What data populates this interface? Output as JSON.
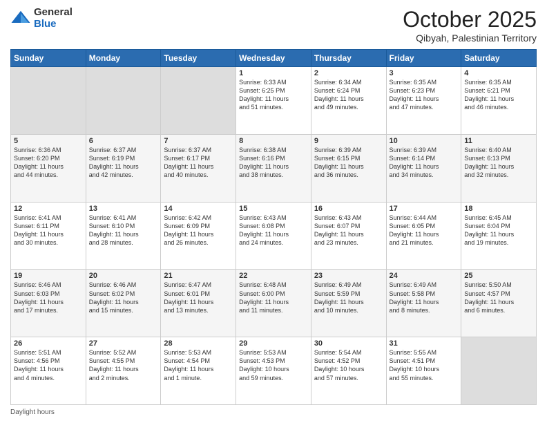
{
  "header": {
    "logo_general": "General",
    "logo_blue": "Blue",
    "month_title": "October 2025",
    "location": "Qibyah, Palestinian Territory"
  },
  "footer": {
    "daylight_label": "Daylight hours"
  },
  "days_of_week": [
    "Sunday",
    "Monday",
    "Tuesday",
    "Wednesday",
    "Thursday",
    "Friday",
    "Saturday"
  ],
  "weeks": [
    {
      "row_class": "row-1",
      "days": [
        {
          "number": "",
          "info": "",
          "empty": true
        },
        {
          "number": "",
          "info": "",
          "empty": true
        },
        {
          "number": "",
          "info": "",
          "empty": true
        },
        {
          "number": "1",
          "info": "Sunrise: 6:33 AM\nSunset: 6:25 PM\nDaylight: 11 hours\nand 51 minutes.",
          "empty": false
        },
        {
          "number": "2",
          "info": "Sunrise: 6:34 AM\nSunset: 6:24 PM\nDaylight: 11 hours\nand 49 minutes.",
          "empty": false
        },
        {
          "number": "3",
          "info": "Sunrise: 6:35 AM\nSunset: 6:23 PM\nDaylight: 11 hours\nand 47 minutes.",
          "empty": false
        },
        {
          "number": "4",
          "info": "Sunrise: 6:35 AM\nSunset: 6:21 PM\nDaylight: 11 hours\nand 46 minutes.",
          "empty": false
        }
      ]
    },
    {
      "row_class": "row-2",
      "days": [
        {
          "number": "5",
          "info": "Sunrise: 6:36 AM\nSunset: 6:20 PM\nDaylight: 11 hours\nand 44 minutes.",
          "empty": false
        },
        {
          "number": "6",
          "info": "Sunrise: 6:37 AM\nSunset: 6:19 PM\nDaylight: 11 hours\nand 42 minutes.",
          "empty": false
        },
        {
          "number": "7",
          "info": "Sunrise: 6:37 AM\nSunset: 6:17 PM\nDaylight: 11 hours\nand 40 minutes.",
          "empty": false
        },
        {
          "number": "8",
          "info": "Sunrise: 6:38 AM\nSunset: 6:16 PM\nDaylight: 11 hours\nand 38 minutes.",
          "empty": false
        },
        {
          "number": "9",
          "info": "Sunrise: 6:39 AM\nSunset: 6:15 PM\nDaylight: 11 hours\nand 36 minutes.",
          "empty": false
        },
        {
          "number": "10",
          "info": "Sunrise: 6:39 AM\nSunset: 6:14 PM\nDaylight: 11 hours\nand 34 minutes.",
          "empty": false
        },
        {
          "number": "11",
          "info": "Sunrise: 6:40 AM\nSunset: 6:13 PM\nDaylight: 11 hours\nand 32 minutes.",
          "empty": false
        }
      ]
    },
    {
      "row_class": "row-3",
      "days": [
        {
          "number": "12",
          "info": "Sunrise: 6:41 AM\nSunset: 6:11 PM\nDaylight: 11 hours\nand 30 minutes.",
          "empty": false
        },
        {
          "number": "13",
          "info": "Sunrise: 6:41 AM\nSunset: 6:10 PM\nDaylight: 11 hours\nand 28 minutes.",
          "empty": false
        },
        {
          "number": "14",
          "info": "Sunrise: 6:42 AM\nSunset: 6:09 PM\nDaylight: 11 hours\nand 26 minutes.",
          "empty": false
        },
        {
          "number": "15",
          "info": "Sunrise: 6:43 AM\nSunset: 6:08 PM\nDaylight: 11 hours\nand 24 minutes.",
          "empty": false
        },
        {
          "number": "16",
          "info": "Sunrise: 6:43 AM\nSunset: 6:07 PM\nDaylight: 11 hours\nand 23 minutes.",
          "empty": false
        },
        {
          "number": "17",
          "info": "Sunrise: 6:44 AM\nSunset: 6:05 PM\nDaylight: 11 hours\nand 21 minutes.",
          "empty": false
        },
        {
          "number": "18",
          "info": "Sunrise: 6:45 AM\nSunset: 6:04 PM\nDaylight: 11 hours\nand 19 minutes.",
          "empty": false
        }
      ]
    },
    {
      "row_class": "row-4",
      "days": [
        {
          "number": "19",
          "info": "Sunrise: 6:46 AM\nSunset: 6:03 PM\nDaylight: 11 hours\nand 17 minutes.",
          "empty": false
        },
        {
          "number": "20",
          "info": "Sunrise: 6:46 AM\nSunset: 6:02 PM\nDaylight: 11 hours\nand 15 minutes.",
          "empty": false
        },
        {
          "number": "21",
          "info": "Sunrise: 6:47 AM\nSunset: 6:01 PM\nDaylight: 11 hours\nand 13 minutes.",
          "empty": false
        },
        {
          "number": "22",
          "info": "Sunrise: 6:48 AM\nSunset: 6:00 PM\nDaylight: 11 hours\nand 11 minutes.",
          "empty": false
        },
        {
          "number": "23",
          "info": "Sunrise: 6:49 AM\nSunset: 5:59 PM\nDaylight: 11 hours\nand 10 minutes.",
          "empty": false
        },
        {
          "number": "24",
          "info": "Sunrise: 6:49 AM\nSunset: 5:58 PM\nDaylight: 11 hours\nand 8 minutes.",
          "empty": false
        },
        {
          "number": "25",
          "info": "Sunrise: 5:50 AM\nSunset: 4:57 PM\nDaylight: 11 hours\nand 6 minutes.",
          "empty": false
        }
      ]
    },
    {
      "row_class": "row-5",
      "days": [
        {
          "number": "26",
          "info": "Sunrise: 5:51 AM\nSunset: 4:56 PM\nDaylight: 11 hours\nand 4 minutes.",
          "empty": false
        },
        {
          "number": "27",
          "info": "Sunrise: 5:52 AM\nSunset: 4:55 PM\nDaylight: 11 hours\nand 2 minutes.",
          "empty": false
        },
        {
          "number": "28",
          "info": "Sunrise: 5:53 AM\nSunset: 4:54 PM\nDaylight: 11 hours\nand 1 minute.",
          "empty": false
        },
        {
          "number": "29",
          "info": "Sunrise: 5:53 AM\nSunset: 4:53 PM\nDaylight: 10 hours\nand 59 minutes.",
          "empty": false
        },
        {
          "number": "30",
          "info": "Sunrise: 5:54 AM\nSunset: 4:52 PM\nDaylight: 10 hours\nand 57 minutes.",
          "empty": false
        },
        {
          "number": "31",
          "info": "Sunrise: 5:55 AM\nSunset: 4:51 PM\nDaylight: 10 hours\nand 55 minutes.",
          "empty": false
        },
        {
          "number": "",
          "info": "",
          "empty": true
        }
      ]
    }
  ]
}
